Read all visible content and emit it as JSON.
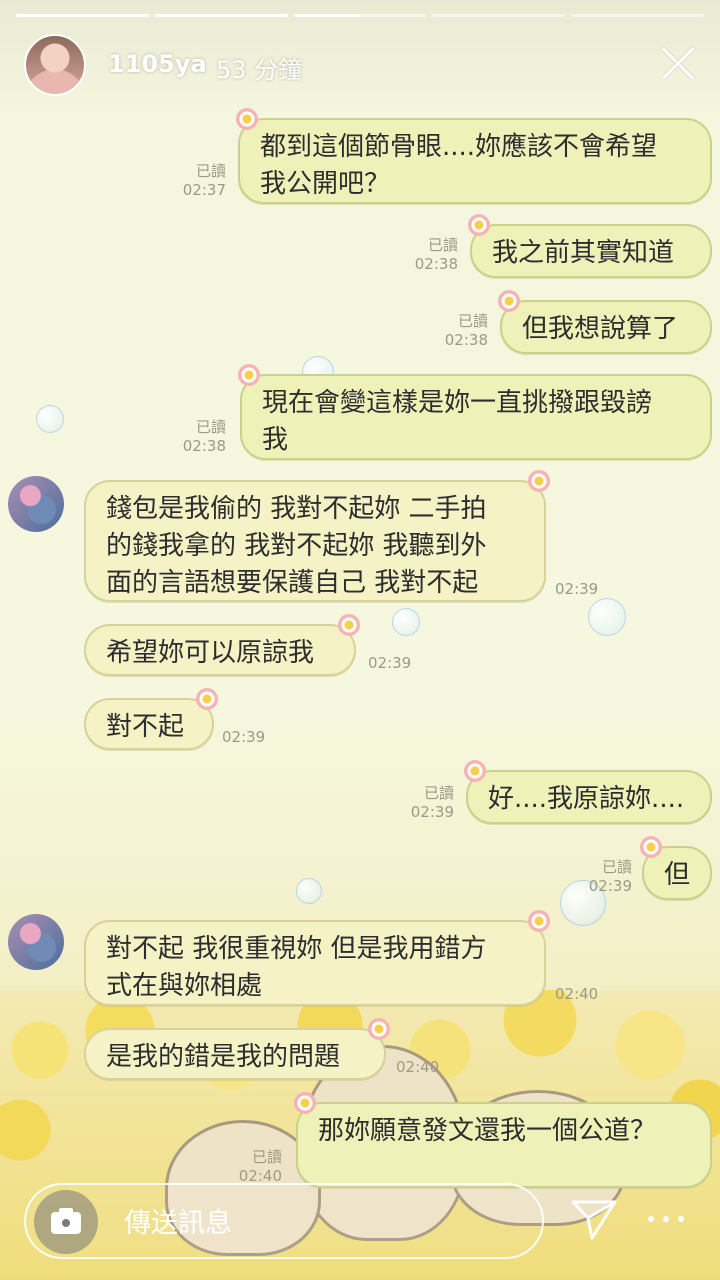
{
  "story": {
    "username": "1105ya",
    "time_ago": "53 分鐘",
    "progress": [
      1,
      1,
      0.5,
      0,
      0
    ]
  },
  "messages": [
    {
      "dir": "out",
      "text": "都到這個節骨眼....妳應該不會希望\n我公開吧？",
      "read": "已讀",
      "time": "02:37"
    },
    {
      "dir": "out",
      "text": "我之前其實知道",
      "read": "已讀",
      "time": "02:38"
    },
    {
      "dir": "out",
      "text": "但我想說算了",
      "read": "已讀",
      "time": "02:38"
    },
    {
      "dir": "out",
      "text": "現在會變這樣是妳一直挑撥跟毀謗\n我",
      "read": "已讀",
      "time": "02:38"
    },
    {
      "dir": "in",
      "text": "錢包是我偷的 我對不起妳 二手拍\n的錢我拿的 我對不起妳 我聽到外\n面的言語想要保護自己 我對不起",
      "time": "02:39"
    },
    {
      "dir": "in",
      "text": "希望妳可以原諒我",
      "time": "02:39"
    },
    {
      "dir": "in",
      "text": "對不起",
      "time": "02:39"
    },
    {
      "dir": "out",
      "text": "好....我原諒妳....",
      "read": "已讀",
      "time": "02:39"
    },
    {
      "dir": "out",
      "text": "但",
      "read": "已讀",
      "time": "02:39"
    },
    {
      "dir": "in",
      "text": "對不起 我很重視妳 但是我用錯方\n式在與妳相處",
      "time": "02:40"
    },
    {
      "dir": "in",
      "text": "是我的錯是我的問題",
      "time": "02:40"
    },
    {
      "dir": "out",
      "text": "那妳願意發文還我一個公道？",
      "read": "已讀",
      "time": "02:40"
    }
  ],
  "composer": {
    "placeholder": "傳送訊息"
  },
  "icons": {
    "camera": "camera-icon",
    "send": "paper-plane-icon",
    "more": "more-dots-icon",
    "close": "close-icon"
  }
}
